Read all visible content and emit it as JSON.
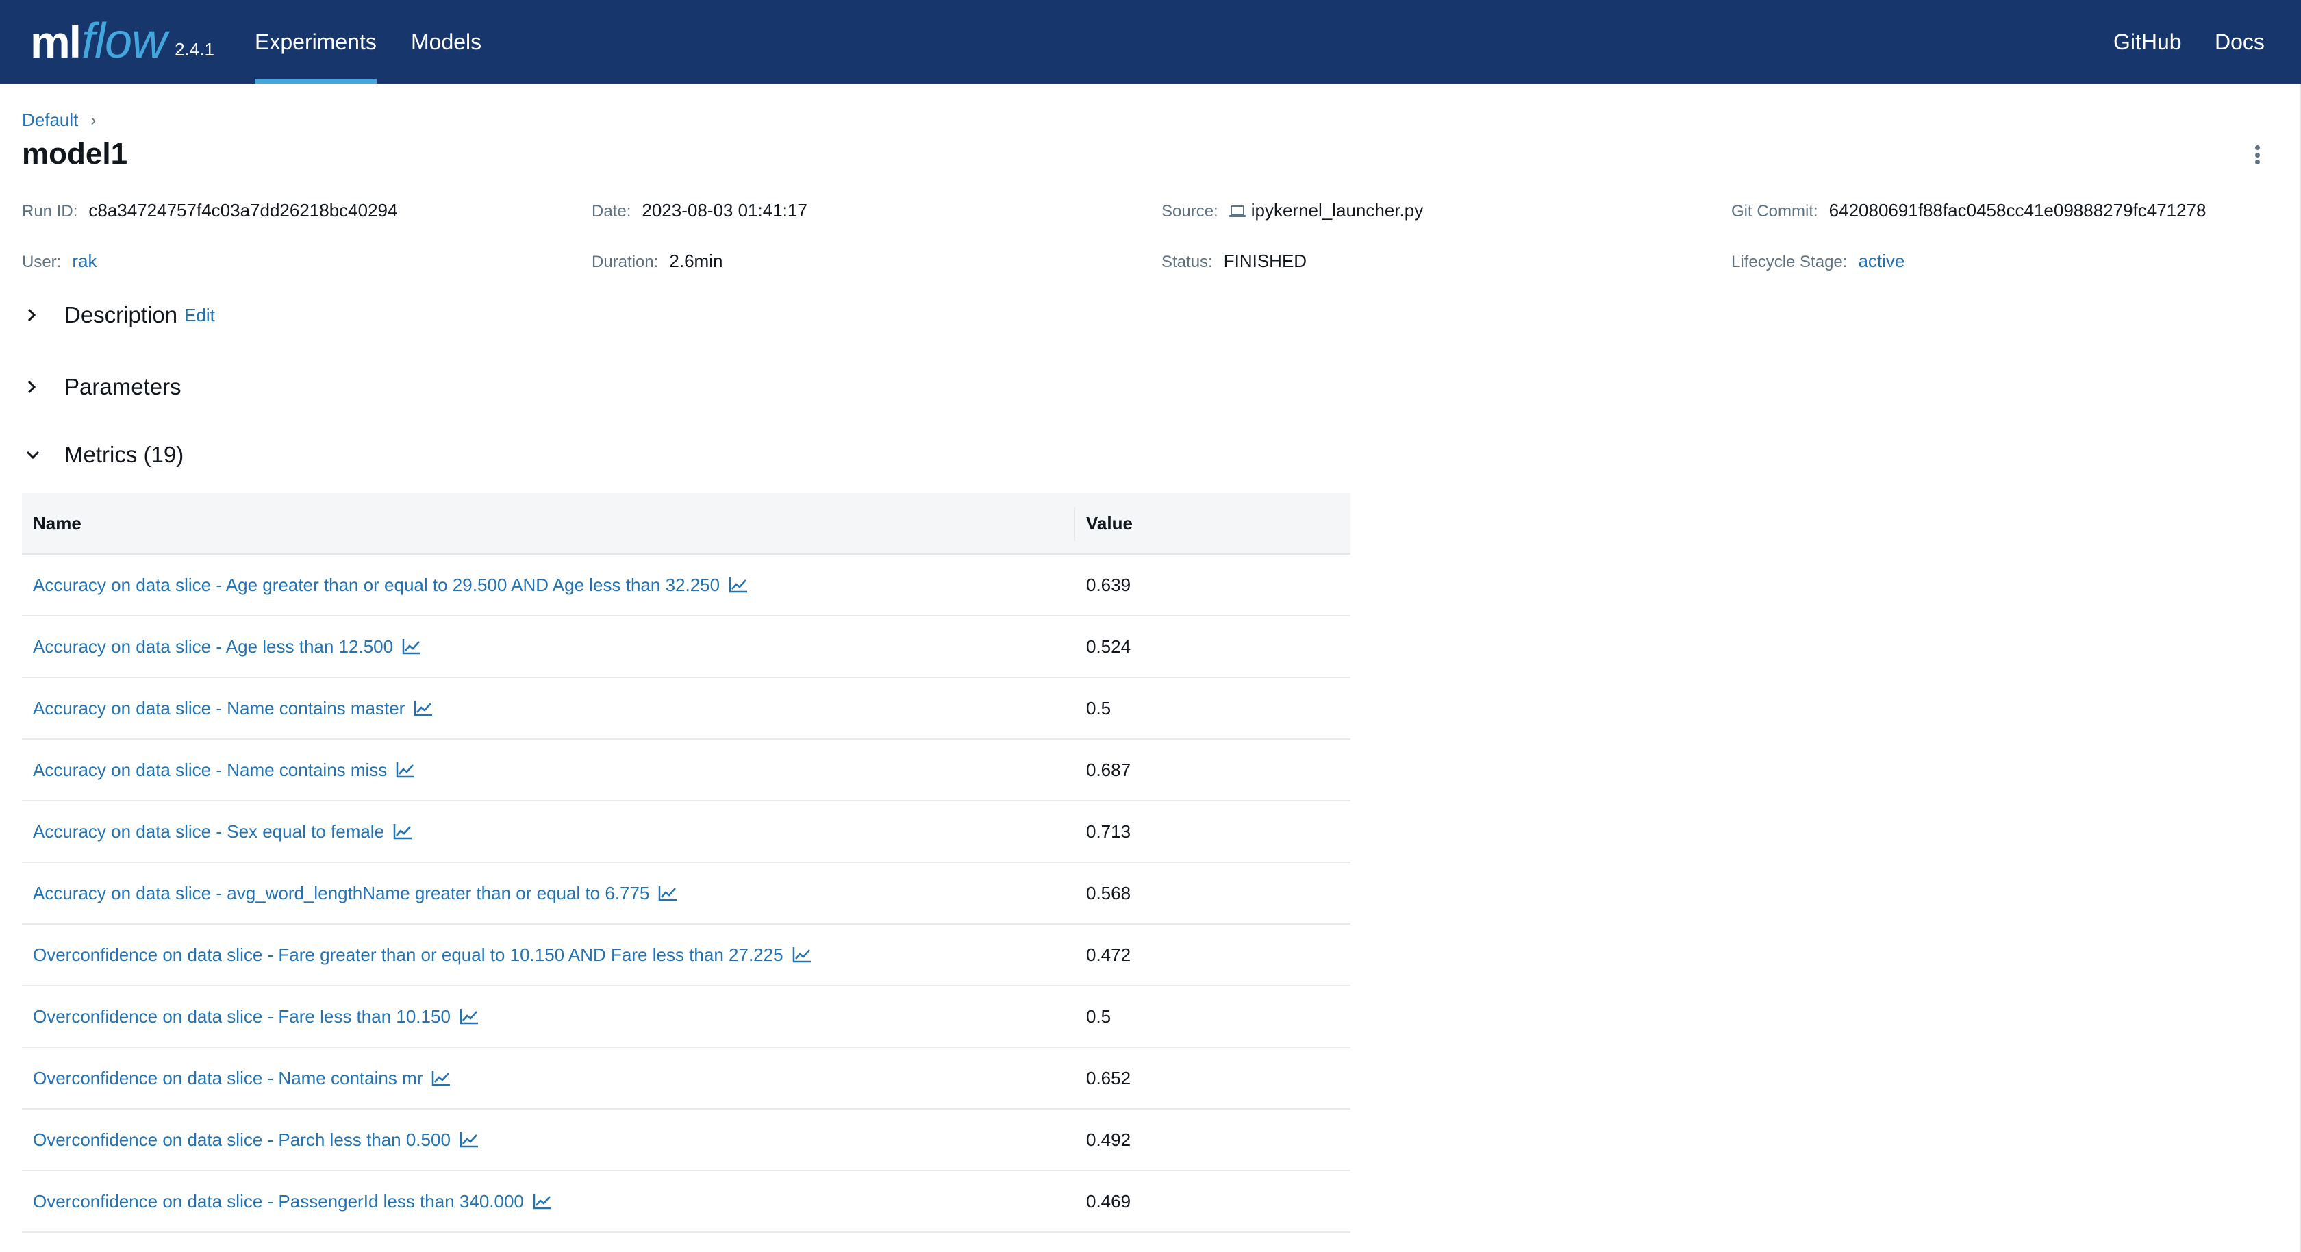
{
  "app": {
    "logo_ml": "ml",
    "logo_flow": "flow",
    "version": "2.4.1"
  },
  "nav": {
    "experiments": "Experiments",
    "models": "Models",
    "github": "GitHub",
    "docs": "Docs",
    "accent": "#43a6dc",
    "bg": "#17366b"
  },
  "breadcrumb": {
    "parent": "Default",
    "separator": "›"
  },
  "run": {
    "title": "model1",
    "run_id_label": "Run ID:",
    "run_id": "c8a34724757f4c03a7dd26218bc40294",
    "date_label": "Date:",
    "date": "2023-08-03 01:41:17",
    "source_label": "Source:",
    "source": "ipykernel_launcher.py",
    "git_label": "Git Commit:",
    "git_commit": "642080691f88fac0458cc41e09888279fc471278",
    "user_label": "User:",
    "user": "rak",
    "duration_label": "Duration:",
    "duration": "2.6min",
    "status_label": "Status:",
    "status": "FINISHED",
    "lifecycle_label": "Lifecycle Stage:",
    "lifecycle": "active"
  },
  "sections": {
    "description": "Description",
    "description_edit": "Edit",
    "parameters": "Parameters",
    "metrics": "Metrics (19)"
  },
  "metrics_table": {
    "col_name": "Name",
    "col_value": "Value",
    "rows": [
      {
        "name": "Accuracy on data slice - Age greater than or equal to 29.500 AND Age less than 32.250",
        "value": "0.639"
      },
      {
        "name": "Accuracy on data slice - Age less than 12.500",
        "value": "0.524"
      },
      {
        "name": "Accuracy on data slice - Name contains master",
        "value": "0.5"
      },
      {
        "name": "Accuracy on data slice - Name contains miss",
        "value": "0.687"
      },
      {
        "name": "Accuracy on data slice - Sex equal to female",
        "value": "0.713"
      },
      {
        "name": "Accuracy on data slice - avg_word_lengthName greater than or equal to 6.775",
        "value": "0.568"
      },
      {
        "name": "Overconfidence on data slice - Fare greater than or equal to 10.150 AND Fare less than 27.225",
        "value": "0.472"
      },
      {
        "name": "Overconfidence on data slice - Fare less than 10.150",
        "value": "0.5"
      },
      {
        "name": "Overconfidence on data slice - Name contains mr",
        "value": "0.652"
      },
      {
        "name": "Overconfidence on data slice - Parch less than 0.500",
        "value": "0.492"
      },
      {
        "name": "Overconfidence on data slice - PassengerId less than 340.000",
        "value": "0.469"
      }
    ]
  }
}
